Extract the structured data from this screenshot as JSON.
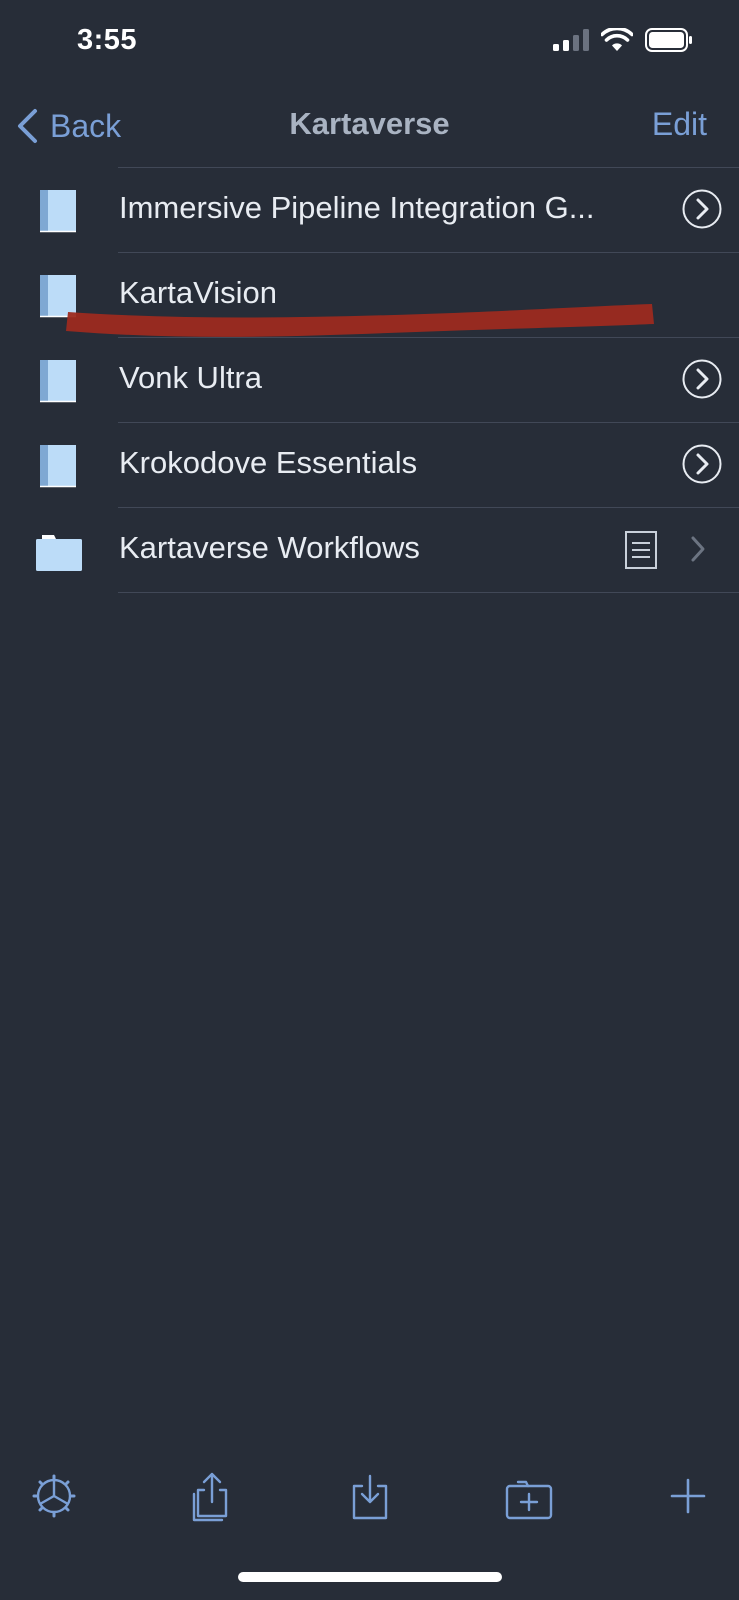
{
  "status_bar": {
    "time": "3:55"
  },
  "nav": {
    "back_label": "Back",
    "title": "Kartaverse",
    "edit_label": "Edit"
  },
  "items": [
    {
      "label": "Immersive Pipeline Integration G...",
      "icon": "book-icon",
      "accessory": "disclosure-circle-icon"
    },
    {
      "label": "KartaVision",
      "icon": "book-icon",
      "accessory": "none",
      "redacted": true
    },
    {
      "label": "Vonk Ultra",
      "icon": "book-icon",
      "accessory": "disclosure-circle-icon"
    },
    {
      "label": "Krokodove Essentials",
      "icon": "book-icon",
      "accessory": "disclosure-circle-icon"
    },
    {
      "label": "Kartaverse Workflows",
      "icon": "folder-icon",
      "accessory": "document-icon + chevron-right-icon"
    }
  ],
  "toolbar": [
    "settings-gear-icon",
    "share-icon",
    "import-icon",
    "new-folder-icon",
    "add-icon"
  ],
  "colors": {
    "background": "#272d38",
    "accent": "#7a9fd6",
    "icon_fill": "#bcdcf8",
    "redaction": "#9c2a1f"
  }
}
